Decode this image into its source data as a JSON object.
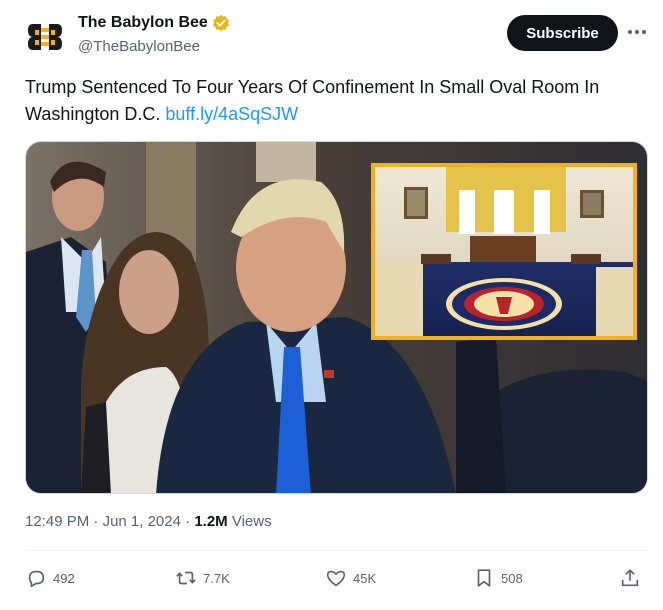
{
  "account": {
    "display_name": "The Babylon Bee",
    "handle": "@TheBabylonBee",
    "verified_badge_icon": "verified-badge-icon",
    "subscribe_label": "Subscribe",
    "more_icon": "more-icon"
  },
  "tweet": {
    "text": "Trump Sentenced To Four Years Of Confinement In Small Oval Room In Washington D.C. ",
    "link": "buff.ly/4aSqSJW"
  },
  "meta": {
    "time": "12:49 PM",
    "sep1": " · ",
    "date": "Jun 1, 2024",
    "sep2": " · ",
    "views_count": "1.2M",
    "views_label": " Views"
  },
  "actions": {
    "replies": "492",
    "reposts": "7.7K",
    "likes": "45K",
    "bookmarks": "508"
  },
  "colors": {
    "accent": "#1d9bf0",
    "text": "#0f1419",
    "secondary": "#536471",
    "badge": "#e2b719",
    "inset_border": "#f2b21b"
  }
}
